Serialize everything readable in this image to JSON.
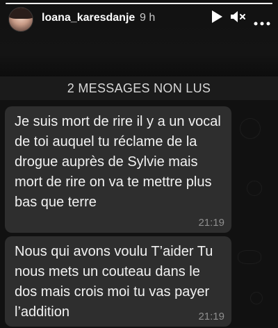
{
  "story": {
    "username": "loana_karesdanje",
    "time_ago": "9 h",
    "progress": 1.0,
    "controls": [
      "play-icon",
      "mute-icon",
      "more-icon"
    ]
  },
  "chat": {
    "unread_banner": "2 MESSAGES NON LUS",
    "messages": [
      {
        "text": "Je suis mort de rire il y a un vocal de toi auquel tu réclame de la drogue auprès de Sylvie mais mort de rire on va te mettre plus bas que terre",
        "time": "21:19"
      },
      {
        "text": "Nous qui avons voulu T’aider Tu nous mets un couteau dans le dos mais crois moi tu vas payer l’addition",
        "time": "21:19"
      }
    ]
  },
  "colors": {
    "background": "#0a0a0a",
    "bubble": "#2e2e2e",
    "banner": "#1b1b1b",
    "timestamp": "#8f8f8f"
  }
}
